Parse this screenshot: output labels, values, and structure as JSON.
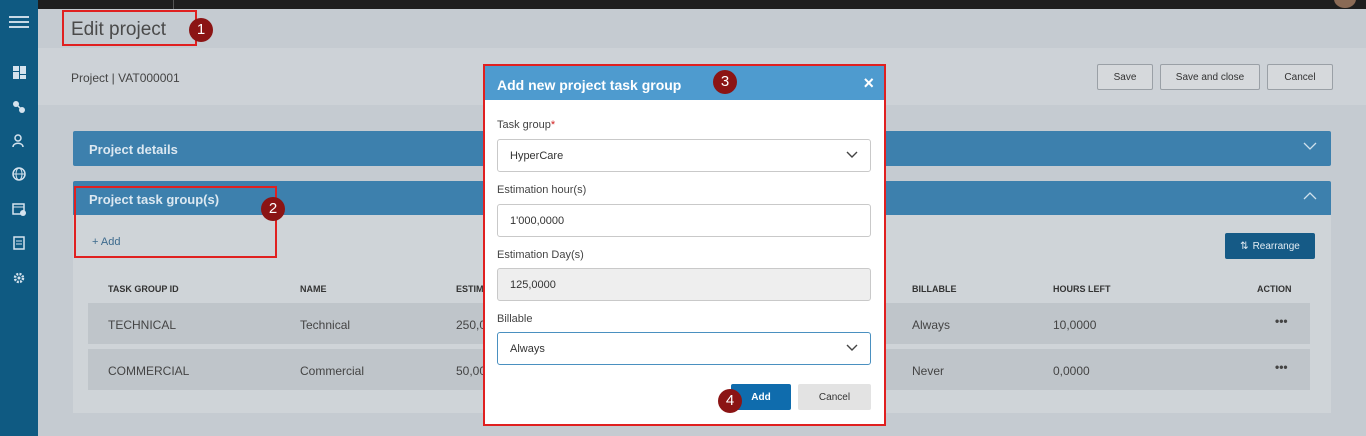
{
  "page": {
    "title": "Edit project",
    "breadcrumb": "Project | VAT000001"
  },
  "toolbar": {
    "save": "Save",
    "save_close": "Save and close",
    "cancel": "Cancel"
  },
  "sidebar": {
    "icons": [
      "dashboard-icon",
      "network-icon",
      "user-search-icon",
      "globe-icon",
      "calendar-icon",
      "report-icon",
      "settings-icon"
    ]
  },
  "panels": {
    "details": "Project details",
    "task_groups": "Project task group(s)"
  },
  "task_groups": {
    "add_label": "+ Add",
    "rearrange_label": "Rearrange",
    "headers": {
      "id": "TASK GROUP ID",
      "name": "NAME",
      "estim": "ESTIM",
      "billable": "BILLABLE",
      "hours_left": "HOURS LEFT",
      "action": "ACTION"
    },
    "rows": [
      {
        "id": "TECHNICAL",
        "name": "Technical",
        "estim": "250,0",
        "billable": "Always",
        "hours_left": "10,0000",
        "action": "•••"
      },
      {
        "id": "COMMERCIAL",
        "name": "Commercial",
        "estim": "50,00",
        "billable": "Never",
        "hours_left": "0,0000",
        "action": "•••"
      }
    ]
  },
  "modal": {
    "title": "Add new project task group",
    "close": "×",
    "task_group_label": "Task group",
    "required_mark": "*",
    "task_group_value": "HyperCare",
    "est_hours_label": "Estimation hour(s)",
    "est_hours_value": "1'000,0000",
    "est_days_label": "Estimation Day(s)",
    "est_days_value": "125,0000",
    "billable_label": "Billable",
    "billable_value": "Always",
    "add": "Add",
    "cancel": "Cancel"
  },
  "callouts": [
    "1",
    "2",
    "3",
    "4"
  ],
  "colors": {
    "accent": "#0f6cad",
    "panel": "#3d80ad",
    "modal_header": "#4e9bcf",
    "callout": "#8b1414",
    "highlight": "#e02020"
  }
}
